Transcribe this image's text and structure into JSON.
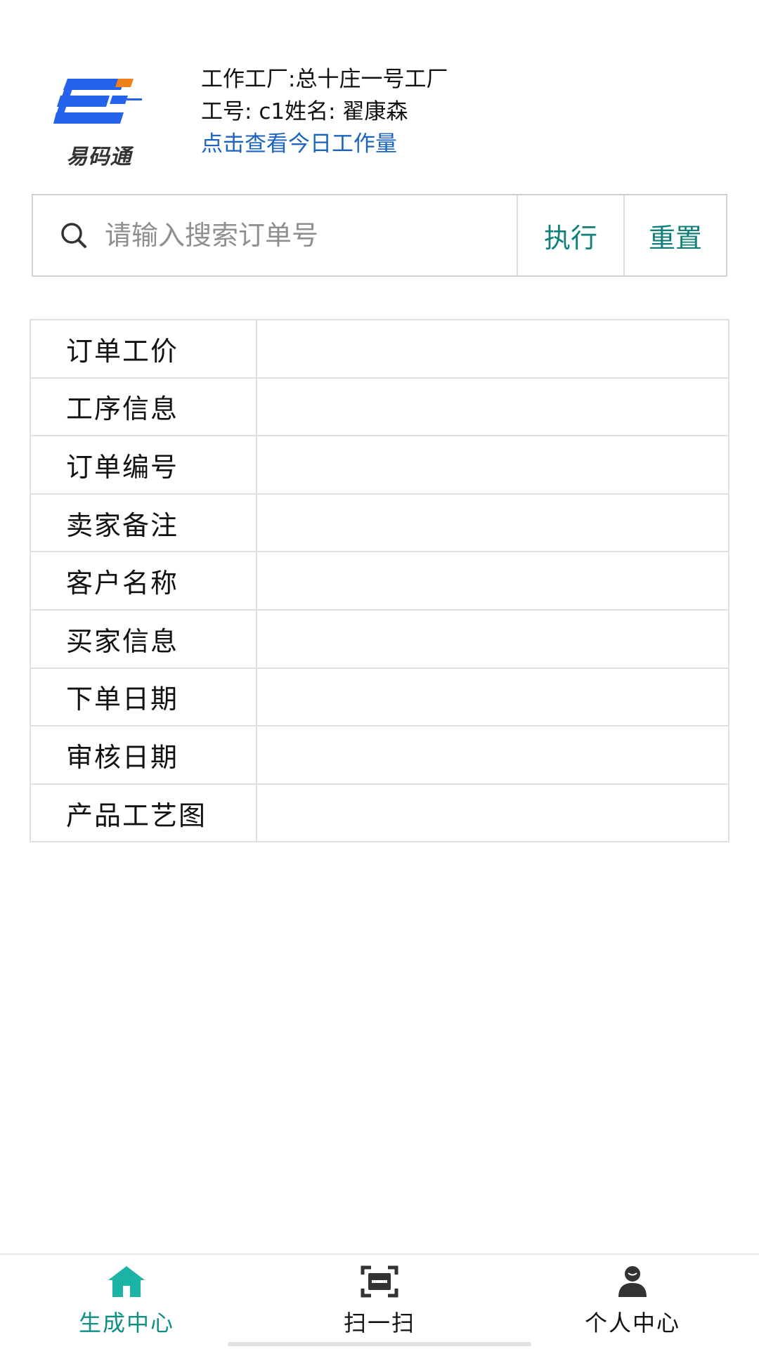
{
  "header": {
    "logo_text": "易码通",
    "factory_line": "工作工厂:总十庄一号工厂",
    "id_label": "工号: ",
    "id_value": "c1",
    "name_label": "姓名: ",
    "name_value": "翟康森",
    "workload_link": "点击查看今日工作量"
  },
  "search": {
    "placeholder": "请输入搜索订单号",
    "value": "",
    "execute_label": "执行",
    "reset_label": "重置"
  },
  "order_table": {
    "rows": [
      {
        "label": "订单工价",
        "value": ""
      },
      {
        "label": "工序信息",
        "value": ""
      },
      {
        "label": "订单编号",
        "value": ""
      },
      {
        "label": "卖家备注",
        "value": ""
      },
      {
        "label": "客户名称",
        "value": ""
      },
      {
        "label": "买家信息",
        "value": ""
      },
      {
        "label": "下单日期",
        "value": ""
      },
      {
        "label": "审核日期",
        "value": ""
      },
      {
        "label": "产品工艺图",
        "value": ""
      }
    ]
  },
  "bottom_nav": {
    "items": [
      {
        "label": "生成中心",
        "icon": "home-icon",
        "active": true
      },
      {
        "label": "扫一扫",
        "icon": "scan-icon",
        "active": false
      },
      {
        "label": "个人中心",
        "icon": "user-icon",
        "active": false
      }
    ]
  },
  "colors": {
    "accent": "#0f8f86",
    "button_text": "#0f7f7a",
    "link": "#1a63c0",
    "logo_blue": "#2563eb",
    "logo_orange": "#f07f1e"
  }
}
